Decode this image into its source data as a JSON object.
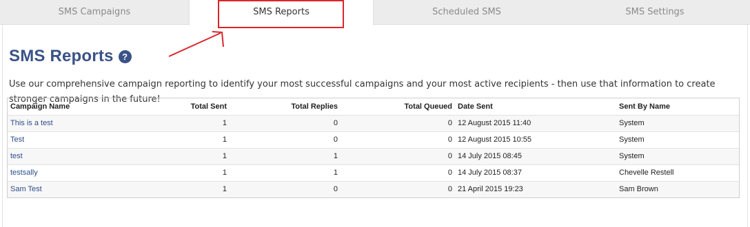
{
  "tabs": [
    {
      "label": "SMS Campaigns"
    },
    {
      "label": "SMS Reports"
    },
    {
      "label": "Scheduled SMS"
    },
    {
      "label": "SMS Settings"
    }
  ],
  "active_tab": "SMS Reports",
  "page": {
    "title": "SMS Reports",
    "help_icon": "question-circle-icon",
    "description": "Use our comprehensive campaign reporting to identify your most successful campaigns and your most active recipients - then use that information to create stronger campaigns in the future!"
  },
  "table": {
    "columns": [
      "Campaign Name",
      "Total Sent",
      "Total Replies",
      "Total Queued",
      "Date Sent",
      "Sent By Name"
    ],
    "rows": [
      {
        "name": "This is a test",
        "sent": "1",
        "replies": "0",
        "queued": "0",
        "date": "12 August 2015 11:40",
        "by": "System"
      },
      {
        "name": "Test",
        "sent": "1",
        "replies": "0",
        "queued": "0",
        "date": "12 August 2015 10:55",
        "by": "System"
      },
      {
        "name": "test",
        "sent": "1",
        "replies": "1",
        "queued": "0",
        "date": "14 July 2015 08:45",
        "by": "System"
      },
      {
        "name": "testsally",
        "sent": "1",
        "replies": "1",
        "queued": "0",
        "date": "14 July 2015 08:37",
        "by": "Chevelle Restell"
      },
      {
        "name": "Sam Test",
        "sent": "1",
        "replies": "0",
        "queued": "0",
        "date": "21 April 2015 19:23",
        "by": "Sam Brown"
      }
    ]
  },
  "colors": {
    "title": "#3a5287",
    "link": "#2e4c8a",
    "annotation": "#d9262c"
  }
}
